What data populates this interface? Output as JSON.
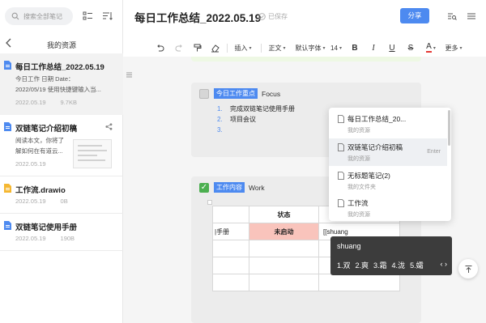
{
  "sidebar": {
    "search_placeholder": "搜索全部笔记",
    "section_title": "我的资源",
    "docs": [
      {
        "name": "每日工作总结_2022.05.19",
        "snippet1": "今日工作 日期 Date：",
        "snippet2": "2022/05/19 使用快捷键输入当...",
        "date": "2022.05.19",
        "size": "9.7KB",
        "icon_color": "#4d8af0"
      },
      {
        "name": "双链笔记介绍初稿",
        "snippet1": "阅读本文，你将了",
        "snippet2": "解如何在有道云...",
        "date": "2022.05.19",
        "size": "",
        "icon_color": "#4d8af0"
      },
      {
        "name": "工作流.drawio",
        "date": "2022.05.19",
        "size": "0B",
        "icon_color": "#f5b731"
      },
      {
        "name": "双链笔记使用手册",
        "date": "2022.05.19",
        "size": "190B",
        "icon_color": "#4d8af0"
      }
    ]
  },
  "header": {
    "title": "每日工作总结_2022.05.19",
    "saved": "已保存",
    "share": "分享"
  },
  "toolbar": {
    "insert": "插入",
    "body": "正文",
    "font": "默认字体",
    "size": "14",
    "more": "更多"
  },
  "editor": {
    "focus_label": "今日工作重点",
    "focus_en": "Focus",
    "items": [
      {
        "num": "1.",
        "text": "完成双链笔记使用手册"
      },
      {
        "num": "2.",
        "text": "项目会议"
      },
      {
        "num": "3.",
        "text": ""
      }
    ],
    "work_label": "工作内容",
    "work_en": "Work",
    "table": {
      "col_status": "状态",
      "row_task": "|手册",
      "row_status": "未启动",
      "row_input": "[[shuang"
    }
  },
  "popup": {
    "items": [
      {
        "title": "每日工作总结_20...",
        "sub": "我的资源",
        "enter": ""
      },
      {
        "title": "双链笔记介绍初稿",
        "sub": "我的资源",
        "enter": "Enter"
      },
      {
        "title": "无标题笔记(2)",
        "sub": "我的文件夹",
        "enter": ""
      },
      {
        "title": "工作流",
        "sub": "我的资源",
        "enter": ""
      }
    ]
  },
  "ime": {
    "pinyin": "shuang",
    "candidates": [
      "1.双",
      "2.爽",
      "3.霜",
      "4.泷",
      "5.孀"
    ],
    "arrows": "‹ ›"
  },
  "colors": {
    "accent": "#4d8af0",
    "pink": "#f9c4bc"
  }
}
